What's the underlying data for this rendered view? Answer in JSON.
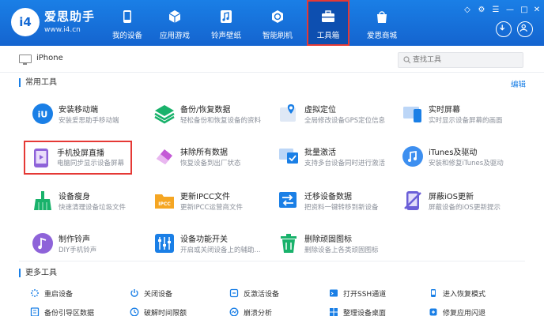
{
  "app": {
    "brand_name": "爱思助手",
    "brand_url": "www.i4.cn",
    "logo_text": "i4"
  },
  "nav": [
    {
      "label": "我的设备",
      "icon": "phone-icon"
    },
    {
      "label": "应用游戏",
      "icon": "cube-icon"
    },
    {
      "label": "铃声壁纸",
      "icon": "music-icon"
    },
    {
      "label": "智能刷机",
      "icon": "refresh-icon"
    },
    {
      "label": "工具箱",
      "icon": "toolbox-icon",
      "active": true
    },
    {
      "label": "爱思商城",
      "icon": "shop-bag-icon"
    }
  ],
  "device": {
    "name": "iPhone"
  },
  "search": {
    "placeholder": "查找工具"
  },
  "sections": {
    "common": "常用工具",
    "edit": "编辑",
    "more": "更多工具"
  },
  "tools": [
    {
      "title": "安装移动端",
      "desc": "安装爱思助手移动端",
      "icon": "i4-mobile-icon",
      "color": "#1a7fe6"
    },
    {
      "title": "备份/恢复数据",
      "desc": "轻松备份和恢复设备的资料",
      "icon": "layers-icon",
      "color": "#19b26b"
    },
    {
      "title": "虚拟定位",
      "desc": "全局修改设备GPS定位信息",
      "icon": "map-pin-icon",
      "color": "#1a7fe6"
    },
    {
      "title": "实时屏幕",
      "desc": "实时显示设备屏幕的画面",
      "icon": "screen-icon",
      "color": "#1a7fe6"
    },
    {
      "title": "手机投屏直播",
      "desc": "电脑同步显示设备屏幕",
      "icon": "screen-cast-icon",
      "color": "#8e63d9",
      "highlight": true
    },
    {
      "title": "抹除所有数据",
      "desc": "恢复设备到出厂状态",
      "icon": "eraser-icon",
      "color": "#c45ad6"
    },
    {
      "title": "批量激活",
      "desc": "支持多台设备同时进行激活",
      "icon": "activate-icon",
      "color": "#1a7fe6"
    },
    {
      "title": "iTunes及驱动",
      "desc": "安装和修复iTunes及驱动",
      "icon": "itunes-icon",
      "color": "#3d8ff0"
    },
    {
      "title": "设备瘦身",
      "desc": "快速清理设备垃圾文件",
      "icon": "broom-icon",
      "color": "#19b26b"
    },
    {
      "title": "更新IPCC文件",
      "desc": "更新IPCC运营商文件",
      "icon": "ipcc-folder-icon",
      "color": "#f5a623"
    },
    {
      "title": "迁移设备数据",
      "desc": "把资料一键转移到新设备",
      "icon": "transfer-icon",
      "color": "#1a7fe6"
    },
    {
      "title": "屏蔽iOS更新",
      "desc": "屏蔽设备的iOS更新提示",
      "icon": "block-update-icon",
      "color": "#6b5fd8"
    },
    {
      "title": "制作铃声",
      "desc": "DIY手机铃声",
      "icon": "ringtone-icon",
      "color": "#8e63d9"
    },
    {
      "title": "设备功能开关",
      "desc": "开启或关闭设备上的辅助...",
      "icon": "switches-icon",
      "color": "#1a7fe6"
    },
    {
      "title": "删除顽固图标",
      "desc": "删除设备上各类顽固图标",
      "icon": "trash-icon",
      "color": "#19b26b"
    }
  ],
  "more_tools": [
    {
      "label": "重启设备",
      "icon": "restart-icon",
      "color": "#1a7fe6"
    },
    {
      "label": "关闭设备",
      "icon": "power-icon",
      "color": "#1a7fe6"
    },
    {
      "label": "反激活设备",
      "icon": "deactivate-icon",
      "color": "#1a7fe6"
    },
    {
      "label": "打开SSH通道",
      "icon": "ssh-icon",
      "color": "#1a7fe6"
    },
    {
      "label": "进入恢复模式",
      "icon": "recovery-icon",
      "color": "#1a7fe6"
    },
    {
      "label": "备份引导区数据",
      "icon": "boot-backup-icon",
      "color": "#1a7fe6"
    },
    {
      "label": "破解时间限额",
      "icon": "clock-icon",
      "color": "#1a7fe6"
    },
    {
      "label": "崩溃分析",
      "icon": "crash-icon",
      "color": "#1a7fe6"
    },
    {
      "label": "整理设备桌面",
      "icon": "desktop-icon",
      "color": "#1a7fe6"
    },
    {
      "label": "修复应用闪退",
      "icon": "repair-icon",
      "color": "#1a7fe6"
    }
  ]
}
